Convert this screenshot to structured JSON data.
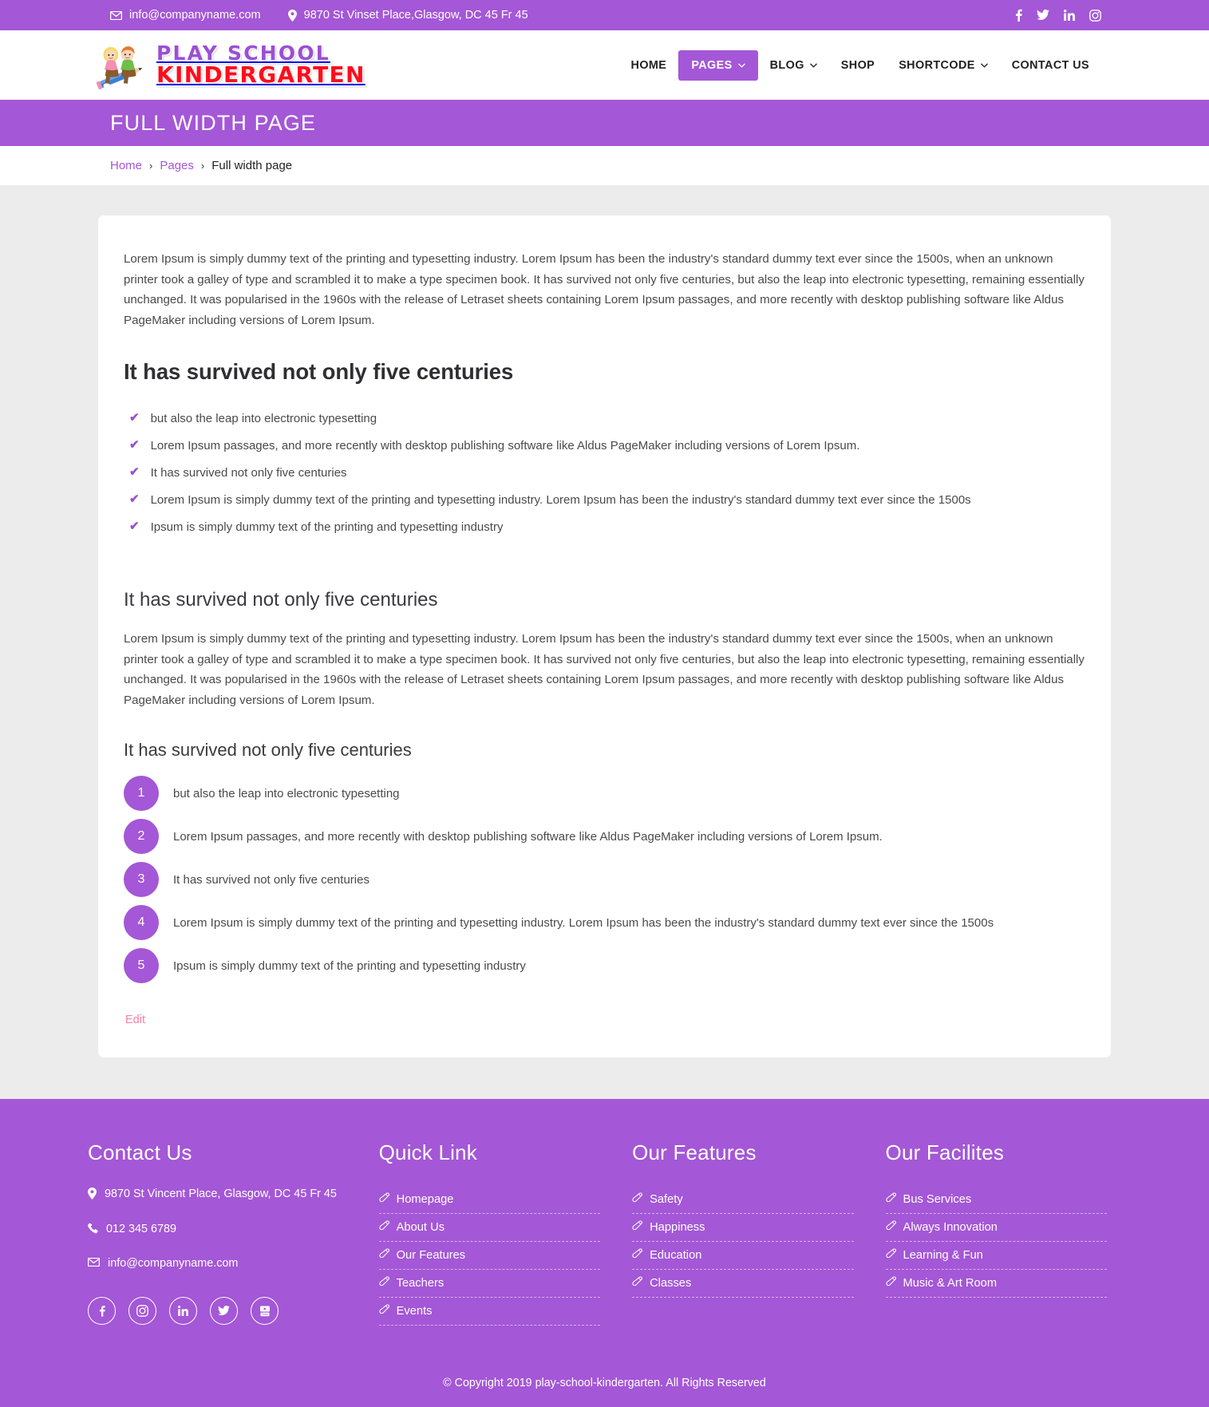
{
  "topbar": {
    "email": "info@companyname.com",
    "address": "9870 St Vinset Place,Glasgow, DC 45 Fr 45",
    "socials": [
      {
        "name": "facebook-icon",
        "label": "Facebook"
      },
      {
        "name": "twitter-icon",
        "label": "Twitter"
      },
      {
        "name": "linkedin-icon",
        "label": "LinkedIn"
      },
      {
        "name": "instagram-icon",
        "label": "Instagram"
      }
    ]
  },
  "logo": {
    "line1": "PLAY SCHOOL",
    "line2": "KINDERGARTEN",
    "line1_color": "#9b4fd4",
    "line2_color": "#ff0d1c"
  },
  "nav": {
    "items": [
      {
        "label": "HOME",
        "active": false,
        "caret": false
      },
      {
        "label": "PAGES",
        "active": true,
        "caret": true
      },
      {
        "label": "BLOG",
        "active": false,
        "caret": true
      },
      {
        "label": "SHOP",
        "active": false,
        "caret": false
      },
      {
        "label": "SHORTCODE",
        "active": false,
        "caret": true
      },
      {
        "label": "CONTACT US",
        "active": false,
        "caret": false
      }
    ]
  },
  "banner": {
    "title": "FULL WIDTH PAGE"
  },
  "breadcrumb": {
    "home": "Home",
    "pages": "Pages",
    "current": "Full width page",
    "separator": "›"
  },
  "content": {
    "intro_paragraph": "Lorem Ipsum is simply dummy text of the printing and typesetting industry. Lorem Ipsum has been the industry's standard dummy text ever since the 1500s, when an unknown printer took a galley of type and scrambled it to make a type specimen book. It has survived not only five centuries, but also the leap into electronic typesetting, remaining essentially unchanged. It was popularised in the 1960s with the release of Letraset sheets containing Lorem Ipsum passages, and more recently with desktop publishing software like Aldus PageMaker including versions of Lorem Ipsum.",
    "heading_1": "It has survived not only five centuries",
    "check_items": [
      "but also the leap into electronic typesetting",
      "Lorem Ipsum passages, and more recently with desktop publishing software like Aldus PageMaker including versions of Lorem Ipsum.",
      "It has survived not only five centuries",
      "Lorem Ipsum is simply dummy text of the printing and typesetting industry. Lorem Ipsum has been the industry's standard dummy text ever since the 1500s",
      "Ipsum is simply dummy text of the printing and typesetting industry"
    ],
    "heading_2": "It has survived not only five centuries",
    "second_paragraph": "Lorem Ipsum is simply dummy text of the printing and typesetting industry. Lorem Ipsum has been the industry's standard dummy text ever since the 1500s, when an unknown printer took a galley of type and scrambled it to make a type specimen book. It has survived not only five centuries, but also the leap into electronic typesetting, remaining essentially unchanged. It was popularised in the 1960s with the release of Letraset sheets containing Lorem Ipsum passages, and more recently with desktop publishing software like Aldus PageMaker including versions of Lorem Ipsum.",
    "heading_3": "It has survived not only five centuries",
    "numbered_items": [
      {
        "num": "1",
        "text": "but also the leap into electronic typesetting"
      },
      {
        "num": "2",
        "text": "Lorem Ipsum passages, and more recently with desktop publishing software like Aldus PageMaker including versions of Lorem Ipsum."
      },
      {
        "num": "3",
        "text": "It has survived not only five centuries"
      },
      {
        "num": "4",
        "text": "Lorem Ipsum is simply dummy text of the printing and typesetting industry. Lorem Ipsum has been the industry's standard dummy text ever since the 1500s"
      },
      {
        "num": "5",
        "text": "Ipsum is simply dummy text of the printing and typesetting industry"
      }
    ],
    "edit_link": "Edit"
  },
  "footer": {
    "contact": {
      "title": "Contact Us",
      "address": "9870 St Vincent Place, Glasgow, DC 45 Fr 45",
      "phone": "012 345 6789",
      "email": "info@companyname.com",
      "socials": [
        {
          "name": "facebook-icon",
          "label": "Facebook"
        },
        {
          "name": "instagram-icon",
          "label": "Instagram"
        },
        {
          "name": "linkedin-icon",
          "label": "LinkedIn"
        },
        {
          "name": "twitter-icon",
          "label": "Twitter"
        },
        {
          "name": "youtube-icon",
          "label": "YouTube"
        }
      ]
    },
    "quick_link": {
      "title": "Quick Link",
      "items": [
        "Homepage",
        "About Us",
        "Our Features",
        "Teachers",
        "Events"
      ]
    },
    "our_features": {
      "title": "Our Features",
      "items": [
        "Safety",
        "Happiness",
        "Education",
        "Classes"
      ]
    },
    "our_facilities": {
      "title": "Our Facilites",
      "items": [
        "Bus Services",
        "Always Innovation",
        "Learning & Fun",
        "Music & Art Room"
      ]
    },
    "copyright": "© Copyright 2019 play-school-kindergarten. All Rights Reserved"
  },
  "colors": {
    "purple": "#a457d6",
    "pink": "#fb7ea3",
    "page_bg": "#ececec",
    "logo_red": "#ff0d1c"
  }
}
